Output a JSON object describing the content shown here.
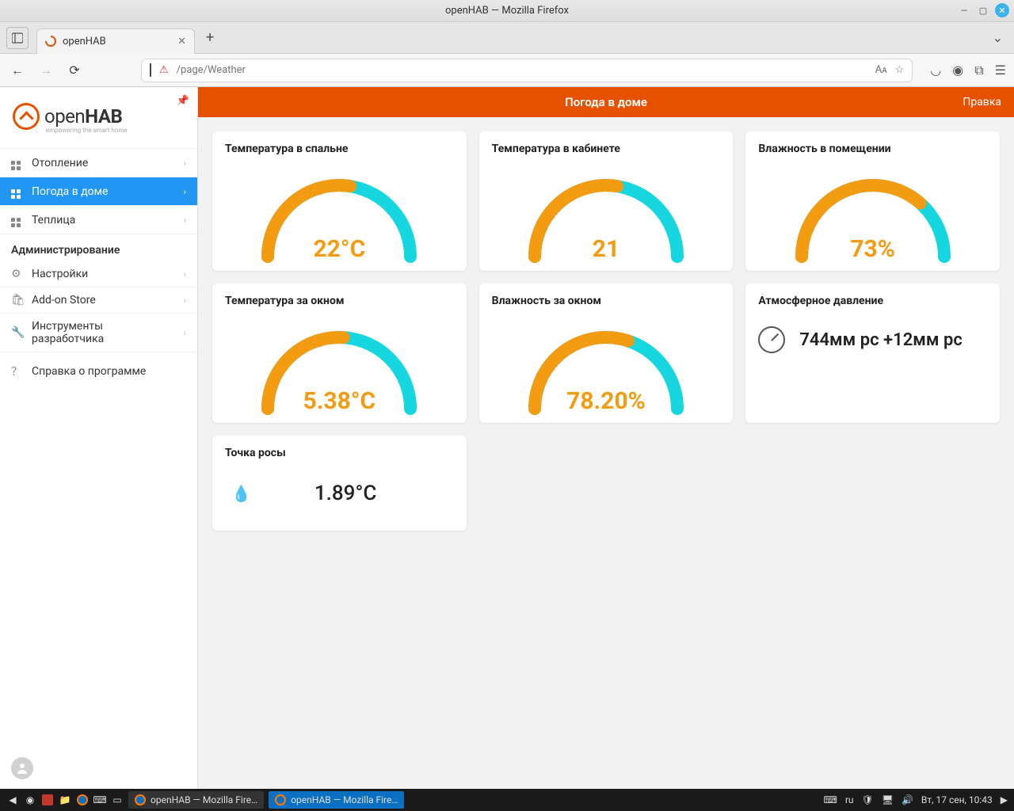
{
  "window": {
    "title": "openHAB — Mozilla Firefox"
  },
  "tab": {
    "title": "openHAB"
  },
  "url": {
    "path": "/page/Weather"
  },
  "logo": {
    "brand_open": "open",
    "brand_hab": "HAB",
    "tagline": "empowering the smart home"
  },
  "sidebar": {
    "items": [
      {
        "label": "Отопление"
      },
      {
        "label": "Погода в доме",
        "active": true
      },
      {
        "label": "Теплица"
      }
    ],
    "admin_header": "Администрирование",
    "admin_items": [
      {
        "label": "Настройки"
      },
      {
        "label": "Add-on Store"
      },
      {
        "label": "Инструменты разработчика"
      },
      {
        "label": "Справка о программе"
      }
    ]
  },
  "page": {
    "title": "Погода в доме",
    "edit": "Правка",
    "cards": {
      "bedroom_temp": {
        "title": "Температура в спальне",
        "value": "22°C",
        "percent": 55
      },
      "office_temp": {
        "title": "Температура в кабинете",
        "value": "21",
        "percent": 55
      },
      "indoor_hum": {
        "title": "Влажность в помещении",
        "value": "73%",
        "percent": 73
      },
      "outdoor_temp": {
        "title": "Температура за окном",
        "value": "5.38°C",
        "percent": 52
      },
      "outdoor_hum": {
        "title": "Влажность за окном",
        "value": "78.20%",
        "percent": 60
      },
      "pressure": {
        "title": "Атмосферное давление",
        "text": "744мм рс +12мм рс"
      },
      "dewpoint": {
        "title": "Точка росы",
        "value": "1.89°C"
      }
    }
  },
  "taskbar": {
    "apps": [
      {
        "label": "openHAB — Mozilla Fire…",
        "active": false
      },
      {
        "label": "openHAB — Mozilla Fire…",
        "active": true
      }
    ],
    "lang": "ru",
    "clock": "Вт, 17 сен, 10:43"
  },
  "chart_data": [
    {
      "type": "gauge",
      "title": "Температура в спальне",
      "value": 22,
      "unit": "°C",
      "min": 0,
      "max": 40,
      "percent": 55
    },
    {
      "type": "gauge",
      "title": "Температура в кабинете",
      "value": 21,
      "unit": "",
      "min": 0,
      "max": 40,
      "percent": 55
    },
    {
      "type": "gauge",
      "title": "Влажность в помещении",
      "value": 73,
      "unit": "%",
      "min": 0,
      "max": 100,
      "percent": 73
    },
    {
      "type": "gauge",
      "title": "Температура за окном",
      "value": 5.38,
      "unit": "°C",
      "min": -20,
      "max": 40,
      "percent": 52
    },
    {
      "type": "gauge",
      "title": "Влажность за окном",
      "value": 78.2,
      "unit": "%",
      "min": 0,
      "max": 100,
      "percent": 60
    }
  ]
}
